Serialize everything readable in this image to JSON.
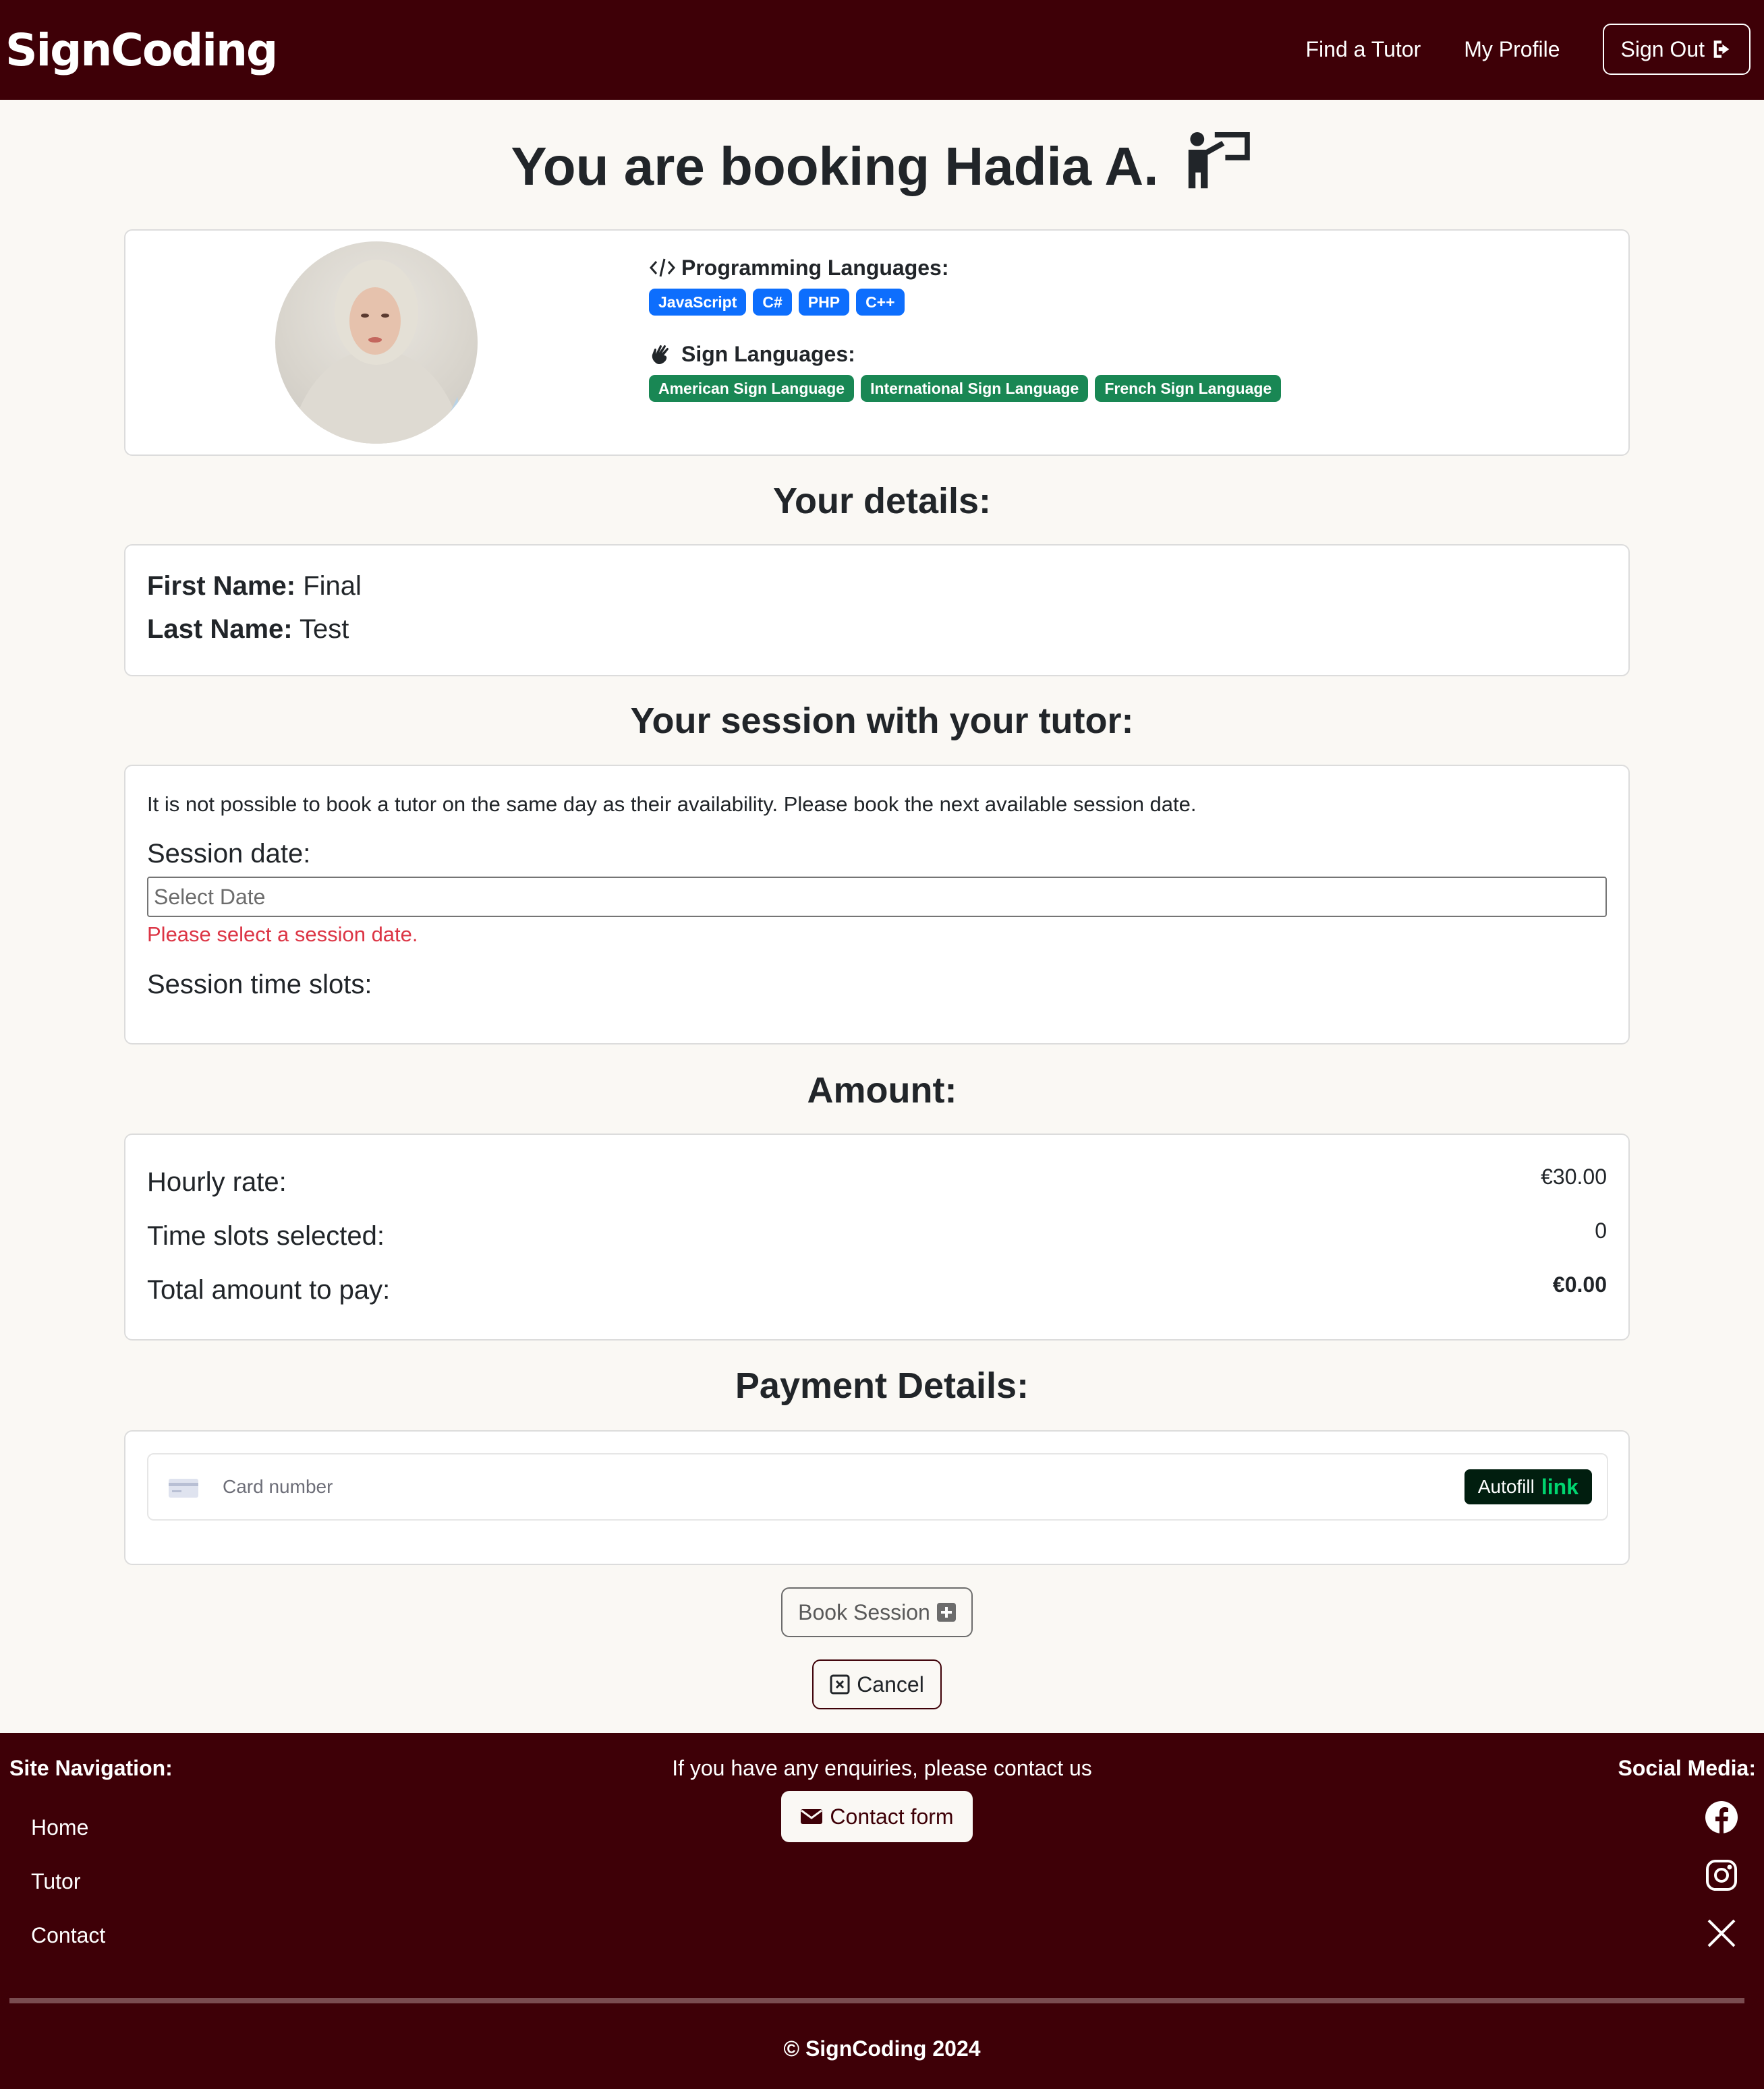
{
  "navbar": {
    "brand": "SignCoding",
    "links": [
      "Find a Tutor",
      "My Profile"
    ],
    "signout_label": "Sign Out"
  },
  "page_title": "You are booking Hadia A.",
  "tutor": {
    "programming_label": "Programming Languages:",
    "programming_languages": [
      "JavaScript",
      "C#",
      "PHP",
      "C++"
    ],
    "sign_label": "Sign Languages:",
    "sign_languages": [
      "American Sign Language",
      "International Sign Language",
      "French Sign Language"
    ]
  },
  "details": {
    "heading": "Your details:",
    "first_name_label": "First Name:",
    "first_name": "Final",
    "last_name_label": "Last Name:",
    "last_name": "Test"
  },
  "session": {
    "heading": "Your session with your tutor:",
    "note": "It is not possible to book a tutor on the same day as their availability. Please book the next available session date.",
    "date_label": "Session date:",
    "date_placeholder": "Select Date",
    "date_error": "Please select a session date.",
    "slots_label": "Session time slots:"
  },
  "amount": {
    "heading": "Amount:",
    "hourly_label": "Hourly rate:",
    "hourly_value": "€30.00",
    "slots_label": "Time slots selected:",
    "slots_value": "0",
    "total_label": "Total amount to pay:",
    "total_value": "€0.00"
  },
  "payment": {
    "heading": "Payment Details:",
    "card_placeholder": "Card number",
    "autofill_label": "Autofill",
    "autofill_link": "link"
  },
  "actions": {
    "book_label": "Book Session",
    "cancel_label": "Cancel"
  },
  "footer": {
    "nav_heading": "Site Navigation:",
    "nav_items": [
      "Home",
      "Tutor",
      "Contact"
    ],
    "enquiry_text": "If you have any enquiries, please contact us",
    "contact_label": "Contact form",
    "social_heading": "Social Media:",
    "social_icons": [
      "facebook-icon",
      "instagram-icon",
      "x-icon"
    ],
    "copyright": "© SignCoding 2024"
  },
  "colors": {
    "brand": "#3e0007",
    "background": "#faf8f4",
    "badge_blue": "#0d6efd",
    "badge_green": "#198754",
    "error": "#dc3545"
  }
}
